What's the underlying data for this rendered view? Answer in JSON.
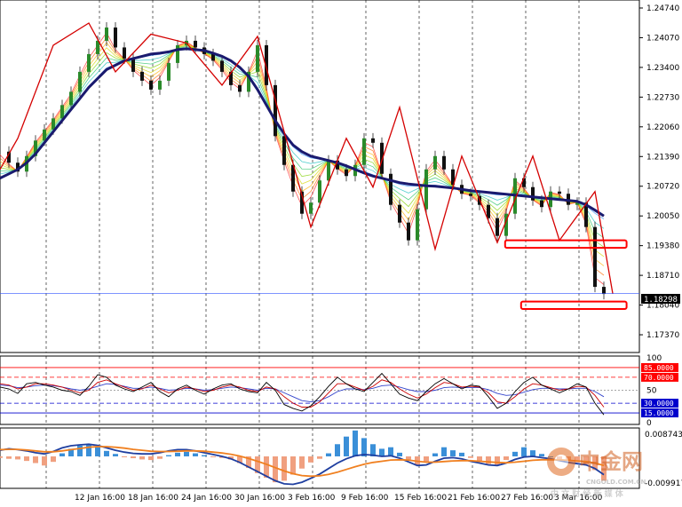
{
  "chart_data": {
    "type": "line",
    "price_axis": {
      "ticks": [
        "1.24740",
        "1.24070",
        "1.23400",
        "1.22730",
        "1.22060",
        "1.21390",
        "1.20720",
        "1.20050",
        "1.19380",
        "1.18710",
        "1.18040",
        "1.17370"
      ],
      "ylim": [
        1.1705,
        1.2484
      ]
    },
    "current_price": "1.18298",
    "x_ticks": [
      "12 Jan 16:00",
      "18 Jan 16:00",
      "24 Jan 16:00",
      "30 Jan 16:00",
      "3 Feb 16:00",
      "9 Feb 16:00",
      "15 Feb 16:00",
      "21 Feb 16:00",
      "27 Feb 16:00",
      "3 Mar 16:00"
    ],
    "price_series": [
      1.215,
      1.2125,
      1.2105,
      1.214,
      1.2175,
      1.22,
      1.2225,
      1.2255,
      1.2285,
      1.233,
      1.237,
      1.24,
      1.243,
      1.2385,
      1.236,
      1.233,
      1.231,
      1.229,
      1.231,
      1.235,
      1.239,
      1.24,
      1.2385,
      1.237,
      1.2355,
      1.233,
      1.23,
      1.2285,
      1.233,
      1.239,
      1.23,
      1.2185,
      1.212,
      1.206,
      1.201,
      1.2035,
      1.2085,
      1.213,
      1.211,
      1.2095,
      1.212,
      1.218,
      1.217,
      1.21,
      1.203,
      1.199,
      1.195,
      1.202,
      1.211,
      1.214,
      1.211,
      1.2075,
      1.2055,
      1.205,
      1.203,
      1.2,
      1.196,
      1.201,
      1.209,
      1.207,
      1.204,
      1.2025,
      1.206,
      1.2055,
      1.203,
      1.2035,
      1.198,
      1.1845,
      1.1829
    ],
    "moving_average": [
      1.209,
      1.21,
      1.211,
      1.2125,
      1.2145,
      1.217,
      1.2195,
      1.222,
      1.2245,
      1.227,
      1.2295,
      1.2315,
      1.2335,
      1.2345,
      1.2355,
      1.236,
      1.2365,
      1.237,
      1.2372,
      1.2375,
      1.238,
      1.2382,
      1.238,
      1.2378,
      1.2372,
      1.2365,
      1.2355,
      1.234,
      1.232,
      1.229,
      1.2255,
      1.222,
      1.219,
      1.2165,
      1.215,
      1.214,
      1.2135,
      1.213,
      1.2125,
      1.2118,
      1.211,
      1.2102,
      1.2095,
      1.209,
      1.2085,
      1.208,
      1.2077,
      1.2075,
      1.2073,
      1.2072,
      1.207,
      1.2068,
      1.2065,
      1.2062,
      1.206,
      1.2058,
      1.2056,
      1.2054,
      1.2052,
      1.205,
      1.2048,
      1.2046,
      1.2044,
      1.2042,
      1.204,
      1.2038,
      1.203,
      1.2018,
      1.2005
    ],
    "zigzag_points": [
      [
        0,
        1.211
      ],
      [
        2,
        1.218
      ],
      [
        6,
        1.239
      ],
      [
        10,
        1.244
      ],
      [
        13,
        1.233
      ],
      [
        17,
        1.2415
      ],
      [
        21,
        1.2395
      ],
      [
        25,
        1.23
      ],
      [
        29,
        1.241
      ],
      [
        35,
        1.198
      ],
      [
        39,
        1.218
      ],
      [
        42,
        1.207
      ],
      [
        45,
        1.225
      ],
      [
        49,
        1.193
      ],
      [
        52,
        1.214
      ],
      [
        56,
        1.1945
      ],
      [
        60,
        1.214
      ],
      [
        63,
        1.195
      ],
      [
        67,
        1.206
      ],
      [
        69,
        1.183
      ]
    ],
    "highlight_boxes": [
      {
        "from": 1.195,
        "to": 1.1933,
        "x0": 0.79,
        "x1": 0.98
      },
      {
        "from": 1.1812,
        "to": 1.1795,
        "x0": 0.815,
        "x1": 0.98
      }
    ],
    "oscillator": {
      "ticks": [
        "100",
        "85.0000",
        "70.0000",
        "50",
        "30.0000",
        "15.0000",
        "0"
      ],
      "levels": {
        "high": 85,
        "upper": 70,
        "mid": 50,
        "lower": 30,
        "low": 15
      },
      "line_main": [
        55,
        52,
        45,
        60,
        62,
        58,
        55,
        50,
        48,
        42,
        56,
        74,
        70,
        58,
        52,
        48,
        55,
        62,
        48,
        40,
        52,
        58,
        50,
        44,
        52,
        58,
        60,
        52,
        48,
        46,
        62,
        50,
        28,
        22,
        18,
        26,
        40,
        56,
        70,
        60,
        52,
        48,
        62,
        76,
        60,
        44,
        38,
        34,
        48,
        60,
        68,
        60,
        52,
        58,
        56,
        40,
        22,
        30,
        48,
        62,
        70,
        58,
        52,
        46,
        52,
        60,
        55,
        30,
        12
      ],
      "line_signal": [
        60,
        58,
        52,
        55,
        60,
        60,
        58,
        55,
        50,
        46,
        50,
        62,
        66,
        60,
        55,
        50,
        52,
        58,
        52,
        46,
        50,
        55,
        52,
        48,
        50,
        55,
        58,
        55,
        50,
        48,
        55,
        52,
        40,
        30,
        24,
        24,
        32,
        46,
        60,
        60,
        55,
        50,
        56,
        66,
        62,
        52,
        44,
        38,
        44,
        54,
        62,
        60,
        55,
        56,
        55,
        46,
        32,
        30,
        40,
        52,
        60,
        58,
        54,
        50,
        52,
        56,
        55,
        42,
        24
      ],
      "line_slow": [
        58,
        57,
        54,
        55,
        57,
        58,
        57,
        55,
        52,
        50,
        52,
        56,
        60,
        59,
        56,
        53,
        53,
        55,
        53,
        50,
        51,
        53,
        52,
        50,
        51,
        53,
        55,
        54,
        52,
        50,
        53,
        52,
        46,
        40,
        34,
        32,
        34,
        40,
        48,
        52,
        52,
        51,
        53,
        57,
        58,
        55,
        51,
        48,
        48,
        50,
        54,
        55,
        54,
        54,
        54,
        51,
        45,
        42,
        43,
        47,
        51,
        53,
        53,
        52,
        52,
        53,
        53,
        48,
        40
      ]
    },
    "macd": {
      "ticks": [
        "0.0087434",
        "-0.0099178"
      ],
      "histogram": [
        -0.0005,
        -0.0008,
        -0.001,
        -0.0015,
        -0.0022,
        -0.003,
        -0.0018,
        0.001,
        0.0025,
        0.0035,
        0.004,
        0.003,
        0.0018,
        0.0008,
        -0.0002,
        -0.0006,
        -0.001,
        -0.0012,
        -0.0008,
        0.0004,
        0.0012,
        0.0015,
        0.001,
        0.0004,
        -0.0002,
        -0.0005,
        -0.001,
        -0.0022,
        -0.0038,
        -0.0055,
        -0.007,
        -0.0085,
        -0.008,
        -0.006,
        -0.004,
        -0.002,
        -0.0008,
        0.001,
        0.004,
        0.0065,
        0.0085,
        0.006,
        0.004,
        0.0025,
        0.003,
        0.0012,
        -0.001,
        -0.003,
        -0.002,
        0.001,
        0.003,
        0.002,
        0.0012,
        -0.0005,
        -0.0015,
        -0.0025,
        -0.003,
        -0.0012,
        0.0015,
        0.003,
        0.002,
        0.0008,
        0.0,
        -0.001,
        -0.0015,
        -0.002,
        -0.0025,
        -0.0045,
        -0.008
      ],
      "macd_line": [
        0.002,
        0.0025,
        0.0022,
        0.0018,
        0.0012,
        0.0008,
        0.0016,
        0.0028,
        0.0035,
        0.0038,
        0.004,
        0.0036,
        0.0028,
        0.002,
        0.0014,
        0.001,
        0.0008,
        0.0008,
        0.0012,
        0.0018,
        0.0022,
        0.0022,
        0.0018,
        0.0012,
        0.0006,
        0.0,
        -0.0008,
        -0.002,
        -0.0035,
        -0.005,
        -0.0065,
        -0.008,
        -0.009,
        -0.0092,
        -0.0085,
        -0.0072,
        -0.0058,
        -0.004,
        -0.0022,
        -0.0008,
        0.0002,
        0.0006,
        0.0004,
        0.0,
        0.0002,
        -0.0006,
        -0.0018,
        -0.003,
        -0.0028,
        -0.0016,
        -0.0006,
        -0.0004,
        -0.0008,
        -0.0016,
        -0.0022,
        -0.0028,
        -0.003,
        -0.0022,
        -0.001,
        -0.0002,
        0.0,
        -0.0004,
        -0.0008,
        -0.0014,
        -0.002,
        -0.0024,
        -0.0028,
        -0.004,
        -0.006
      ],
      "signal_line": [
        0.0022,
        0.0023,
        0.0023,
        0.0021,
        0.0018,
        0.0015,
        0.0015,
        0.0018,
        0.0022,
        0.0026,
        0.003,
        0.0032,
        0.0032,
        0.003,
        0.0027,
        0.0023,
        0.002,
        0.0017,
        0.0016,
        0.0016,
        0.0017,
        0.0018,
        0.0018,
        0.0017,
        0.0014,
        0.0011,
        0.0007,
        0.0001,
        -0.0007,
        -0.0016,
        -0.0026,
        -0.0037,
        -0.0048,
        -0.0057,
        -0.0063,
        -0.0065,
        -0.0064,
        -0.0059,
        -0.0052,
        -0.0043,
        -0.0034,
        -0.0026,
        -0.002,
        -0.0016,
        -0.0012,
        -0.0011,
        -0.0012,
        -0.0016,
        -0.0019,
        -0.0019,
        -0.0017,
        -0.0015,
        -0.0014,
        -0.0014,
        -0.0016,
        -0.0018,
        -0.002,
        -0.0021,
        -0.0019,
        -0.0016,
        -0.0013,
        -0.0011,
        -0.0011,
        -0.0011,
        -0.0013,
        -0.0015,
        -0.0017,
        -0.0022,
        -0.003
      ]
    }
  },
  "colors": {
    "zigzag": "#d40000",
    "moving_average": "#1a1a6e",
    "price_line": "#3355ff",
    "highlight_box": "#ff0000",
    "osc_main": "#000000",
    "osc_signal": "#cc0000",
    "osc_slow": "#3344cc",
    "osc_level_red": "#ff0000",
    "osc_level_blue": "#0000cc",
    "macd_pos": "#3a8fd8",
    "macd_neg": "#f0a080",
    "macd_line": "#1f3fa0",
    "signal_line": "#f08020"
  },
  "watermark": {
    "title": "中金网",
    "domain": "CNGOLD.COM.CN",
    "subtitle": "中 文 财 经 新 媒 体"
  }
}
